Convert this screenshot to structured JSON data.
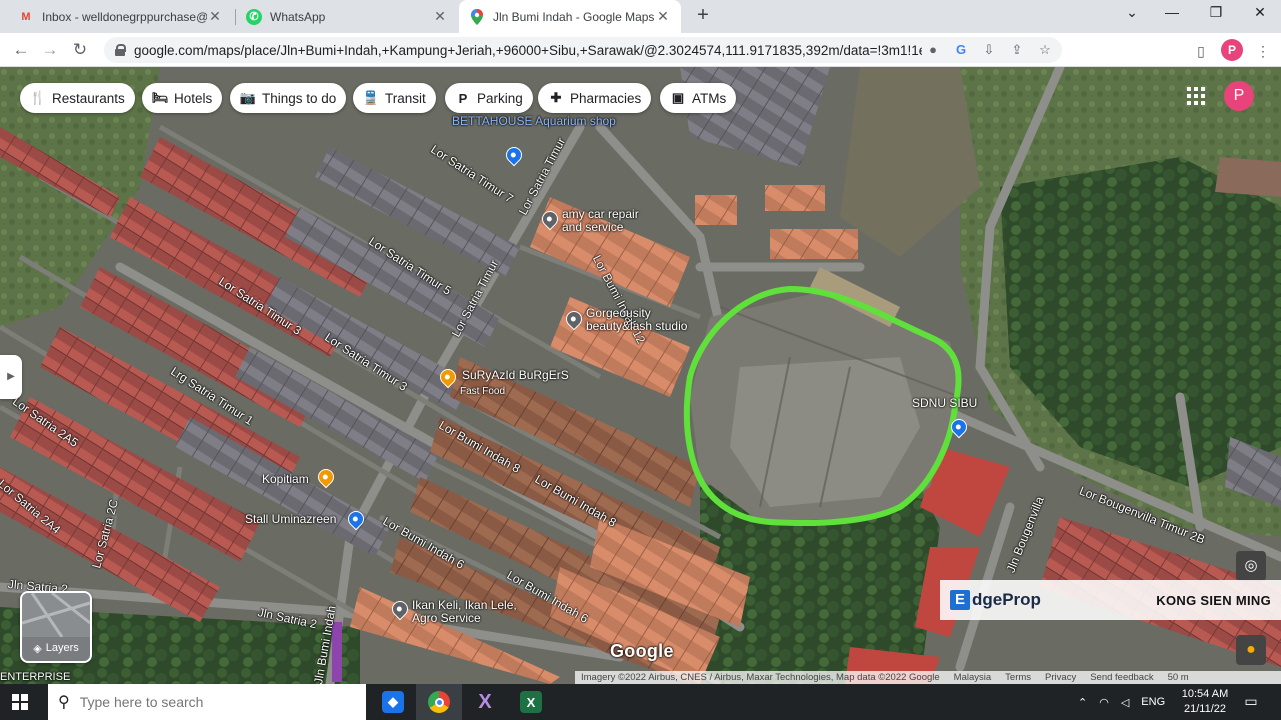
{
  "tabs": [
    {
      "title": "Inbox - welldonegrppurchase@g",
      "favicon": "gmail-icon",
      "color": "#ea4335"
    },
    {
      "title": "WhatsApp",
      "favicon": "whatsapp-icon",
      "color": "#25d366"
    },
    {
      "title": "Jln Bumi Indah - Google Maps",
      "favicon": "google-maps-icon",
      "color": "#34a853"
    }
  ],
  "url": "google.com/maps/place/Jln+Bumi+Indah,+Kampung+Jeriah,+96000+Sibu,+Sarawak/@2.3024574,111.9171835,392m/data=!3m1!1e3!4m6!3m5!1s0x31f...",
  "profile_initial": "P",
  "chips": [
    {
      "label": "Restaurants",
      "icon": "fork-knife-icon"
    },
    {
      "label": "Hotels",
      "icon": "bed-icon"
    },
    {
      "label": "Things to do",
      "icon": "camera-icon"
    },
    {
      "label": "Transit",
      "icon": "train-icon"
    },
    {
      "label": "Parking",
      "icon": "parking-icon"
    },
    {
      "label": "Pharmacies",
      "icon": "pharmacy-icon"
    },
    {
      "label": "ATMs",
      "icon": "atm-icon"
    }
  ],
  "streets": [
    "Lor Satria Timur 7",
    "Lor Satria Timur",
    "Lor Satria Timur 5",
    "Lor Satria Timur 3",
    "Lor Satria Timur 3",
    "Lrg Satria Timur 1",
    "Lor Satria Timur",
    "Lor Satria 2A5",
    "Lor Satria 2A4",
    "Lor Satria 2C",
    "Jln Satria 2",
    "Jln Satria 2",
    "Lor Bumi Indah 12",
    "Lor Bumi Indah 8",
    "Lor Bumi Indah 8",
    "Lor Bumi Indah 6",
    "Lor Bumi Indah 6",
    "Jln Bougenvilla",
    "Lor Bougenvilla Timur 2B",
    "Jln Bumi Indah"
  ],
  "pois": [
    {
      "name": "BETTAHOUSE Aquarium shop"
    },
    {
      "name": "amy car repair and service"
    },
    {
      "name": "Gorgeousity beauty&lash studio"
    },
    {
      "name": "SuRyAzId BuRgErS",
      "sub": "Fast Food"
    },
    {
      "name": "SDNU SIBU"
    },
    {
      "name": "Kopitiam"
    },
    {
      "name": "Stall Uminazreen"
    },
    {
      "name": "Ikan Keli, Ikan Lele, Agro Service"
    }
  ],
  "enterprise_label": "ENTERPRISE",
  "layers_label": "Layers",
  "google_logo": "Google",
  "attribution": {
    "imagery": "Imagery ©2022 Airbus, CNES / Airbus, Maxar Technologies, Map data ©2022 Google",
    "links": [
      "Malaysia",
      "Terms",
      "Privacy",
      "Send feedback"
    ],
    "scale": "50 m"
  },
  "watermark": {
    "brand": "EdgeProp",
    "brand_letter": "E",
    "brand_rest": "dgeProp",
    "agent": "KONG SIEN MING"
  },
  "highlight_color": "#5fe03a",
  "taskbar": {
    "search_placeholder": "Type here to search",
    "apps": [
      {
        "name": "app-blue-icon",
        "color": "#1a73e8"
      },
      {
        "name": "chrome-icon",
        "color": "#ea4335"
      },
      {
        "name": "app-x-icon",
        "color": "#8a4fbf"
      },
      {
        "name": "excel-icon",
        "color": "#1e7145"
      }
    ],
    "language": "ENG",
    "time": "10:54 AM",
    "date": "21/11/22"
  }
}
